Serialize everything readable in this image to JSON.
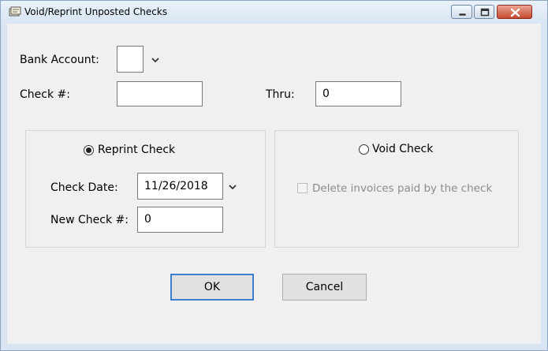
{
  "window": {
    "title": "Void/Reprint Unposted Checks",
    "icon": "checkbook-icon",
    "controls": [
      "minimize-icon",
      "maximize-icon",
      "close-icon"
    ]
  },
  "form": {
    "bank_account_label": "Bank Account:",
    "bank_account_value": "",
    "check_label": "Check #:",
    "check_value": "",
    "thru_label": "Thru:",
    "thru_value": "0"
  },
  "reprint_group": {
    "radio_label": "Reprint Check",
    "selected": true,
    "check_date_label": "Check Date:",
    "check_date_value": "11/26/2018",
    "new_check_label": "New Check #:",
    "new_check_value": "0"
  },
  "void_group": {
    "radio_label": "Void Check",
    "selected": false,
    "delete_invoices_label": "Delete invoices paid by the check",
    "delete_invoices_checked": false,
    "delete_invoices_enabled": false
  },
  "buttons": {
    "ok": "OK",
    "cancel": "Cancel"
  },
  "colors": {
    "title_gradient_top": "#e9f1fb",
    "close_button": "#c74a2f",
    "default_button_border": "#3c7fd1",
    "client_background": "#f0f0f0"
  }
}
